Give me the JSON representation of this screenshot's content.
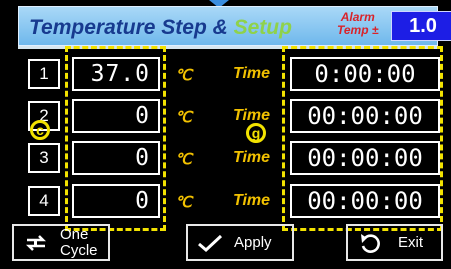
{
  "header": {
    "title_main": "Temperature Step & ",
    "title_accent": "Setup",
    "alarm_label_line1": "Alarm",
    "alarm_label_line2": "Temp ±",
    "alarm_value": "1.0"
  },
  "rows": [
    {
      "num": "1",
      "temp": "37.0",
      "unit": "℃",
      "time_label": "Time",
      "time": "0:00:00"
    },
    {
      "num": "2",
      "temp": "0",
      "unit": "℃",
      "time_label": "Time",
      "time": "00:00:00"
    },
    {
      "num": "3",
      "temp": "0",
      "unit": "℃",
      "time_label": "Time",
      "time": "00:00:00"
    },
    {
      "num": "4",
      "temp": "0",
      "unit": "℃",
      "time_label": "Time",
      "time": "00:00:00"
    }
  ],
  "markers": {
    "temp": "c",
    "time": "g"
  },
  "buttons": {
    "cycle_line1": "One",
    "cycle_line2": "Cycle",
    "apply": "Apply",
    "exit": "Exit"
  },
  "colors": {
    "header_bg": "#8fc8f2",
    "title": "#173a8f",
    "accent": "#8fd24a",
    "alarm": "#d8232a",
    "value_bg": "#1d1ee5",
    "highlight": "#f2e200",
    "unit": "#f2c100"
  }
}
